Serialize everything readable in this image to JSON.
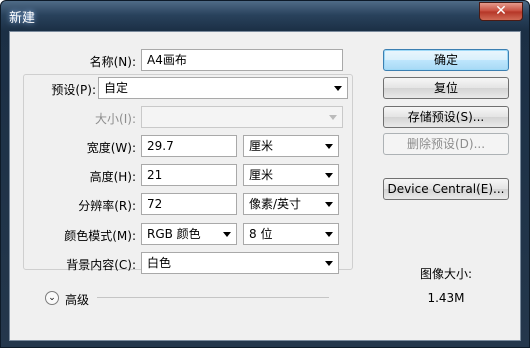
{
  "window": {
    "title": "新建",
    "close_glyph": "✕"
  },
  "form": {
    "name": {
      "label": "名称(N):",
      "value": "A4画布"
    },
    "preset": {
      "label": "预设(P):",
      "value": "自定"
    },
    "size": {
      "label": "大小(I):",
      "value": ""
    },
    "width": {
      "label": "宽度(W):",
      "value": "29.7",
      "unit": "厘米"
    },
    "height": {
      "label": "高度(H):",
      "value": "21",
      "unit": "厘米"
    },
    "resolution": {
      "label": "分辨率(R):",
      "value": "72",
      "unit": "像素/英寸"
    },
    "color_mode": {
      "label": "颜色模式(M):",
      "value": "RGB 颜色",
      "bits": "8 位"
    },
    "background": {
      "label": "背景内容(C):",
      "value": "白色"
    },
    "advanced": {
      "label": "高级",
      "icon_glyph": "⌄"
    }
  },
  "buttons": {
    "ok": "确定",
    "reset": "复位",
    "save_preset": "存储预设(S)...",
    "delete_preset": "删除预设(D)...",
    "device_central": "Device Central(E)..."
  },
  "image_size": {
    "label": "图像大小:",
    "value": "1.43M"
  },
  "icons": {
    "close": "close-icon",
    "dropdown": "chevron-down-icon",
    "advanced": "chevron-down-circle-icon"
  }
}
